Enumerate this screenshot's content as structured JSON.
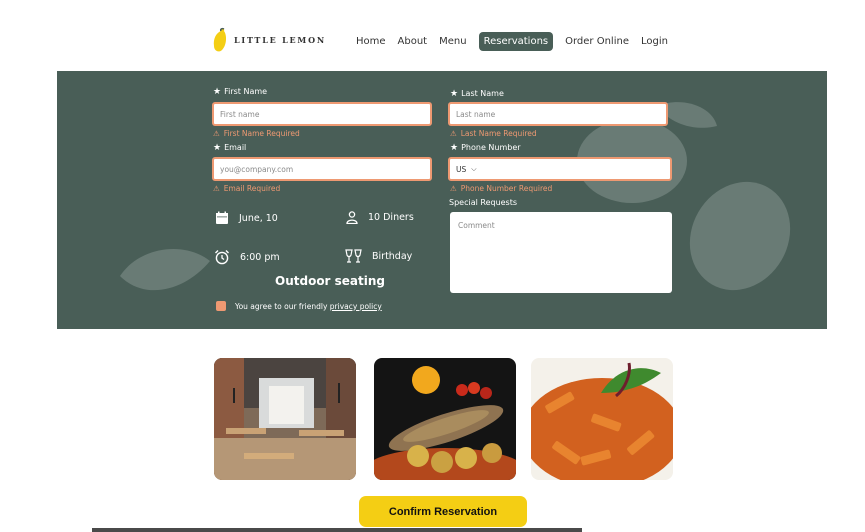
{
  "header": {
    "logo_text": "LITTLE LEMON",
    "nav": [
      "Home",
      "About",
      "Menu",
      "Reservations",
      "Order Online",
      "Login"
    ],
    "active_nav": "Reservations"
  },
  "form": {
    "first_name": {
      "label": "First Name",
      "placeholder": "First name",
      "error": "First Name Required"
    },
    "last_name": {
      "label": "Last Name",
      "placeholder": "Last name",
      "error": "Last Name Required"
    },
    "email": {
      "label": "Email",
      "placeholder": "you@company.com",
      "error": "Email Required"
    },
    "phone": {
      "label": "Phone Number",
      "country": "US",
      "error": "Phone Number Required"
    },
    "special": {
      "label": "Special Requests",
      "placeholder": "Comment"
    },
    "details": {
      "date": "June, 10",
      "diners": "10 Diners",
      "time": "6:00 pm",
      "occasion": "Birthday",
      "seating": "Outdoor seating"
    },
    "agree_text": "You agree to our friendly",
    "agree_link": "privacy policy"
  },
  "confirm_label": "Confirm Reservation",
  "colors": {
    "primary": "#495e57",
    "accent": "#ee9972",
    "yellow": "#f4ce14"
  }
}
